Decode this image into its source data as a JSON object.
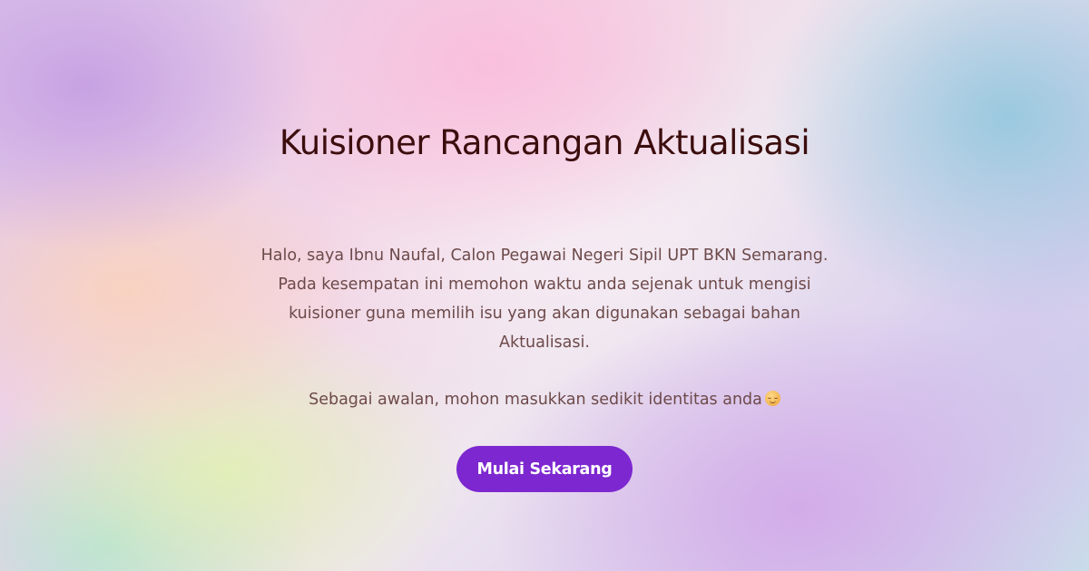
{
  "hero": {
    "title": "Kuisioner Rancangan Aktualisasi",
    "description": "Halo, saya Ibnu Naufal, Calon Pegawai Negeri Sipil UPT BKN Semarang. Pada kesempatan ini memohon waktu anda sejenak untuk mengisi kuisioner guna memilih isu yang akan digunakan sebagai bahan Aktualisasi.",
    "prompt": "Sebagai awalan, mohon masukkan sedikit identitas anda",
    "prompt_icon": "smiling-face-icon",
    "cta_label": "Mulai Sekarang"
  },
  "colors": {
    "title": "#3b0d0d",
    "body_text": "#6d4a4a",
    "button_bg": "#7d27d0",
    "button_text": "#ffffff"
  }
}
